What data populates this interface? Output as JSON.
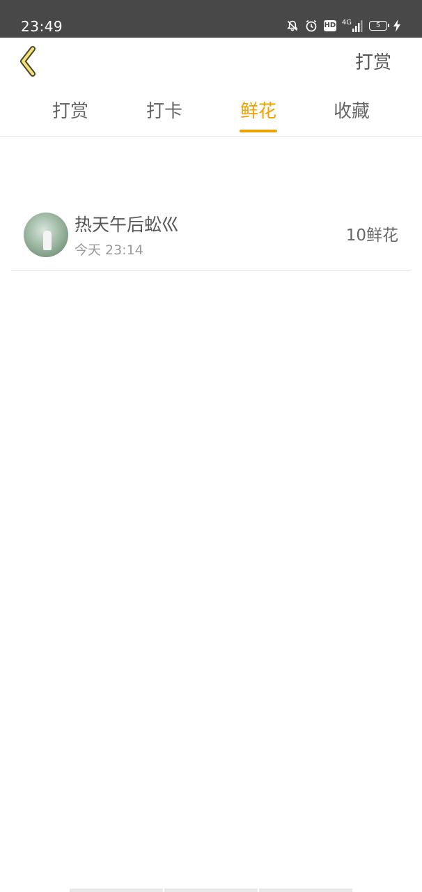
{
  "status_bar": {
    "time": "23:49",
    "network": "4G",
    "hd": "HD",
    "battery_level": "5",
    "icons": [
      "bell-muted-icon",
      "alarm-icon",
      "hd-icon",
      "signal-4g-icon",
      "battery-icon",
      "charging-icon"
    ]
  },
  "header": {
    "back_icon": "chevron-left-icon",
    "action_label": "打赏"
  },
  "tabs": [
    {
      "label": "打赏",
      "active": false
    },
    {
      "label": "打卡",
      "active": false
    },
    {
      "label": "鲜花",
      "active": true
    },
    {
      "label": "收藏",
      "active": false
    }
  ],
  "list": {
    "items": [
      {
        "name": "热天午后蚣巛",
        "time": "今天 23:14",
        "amount": "10鲜花",
        "avatar_icon": "user-avatar"
      }
    ]
  },
  "colors": {
    "accent": "#f0a000",
    "status_bar_bg": "#484848",
    "text_primary": "#555555",
    "text_secondary": "#9a9a9a"
  }
}
